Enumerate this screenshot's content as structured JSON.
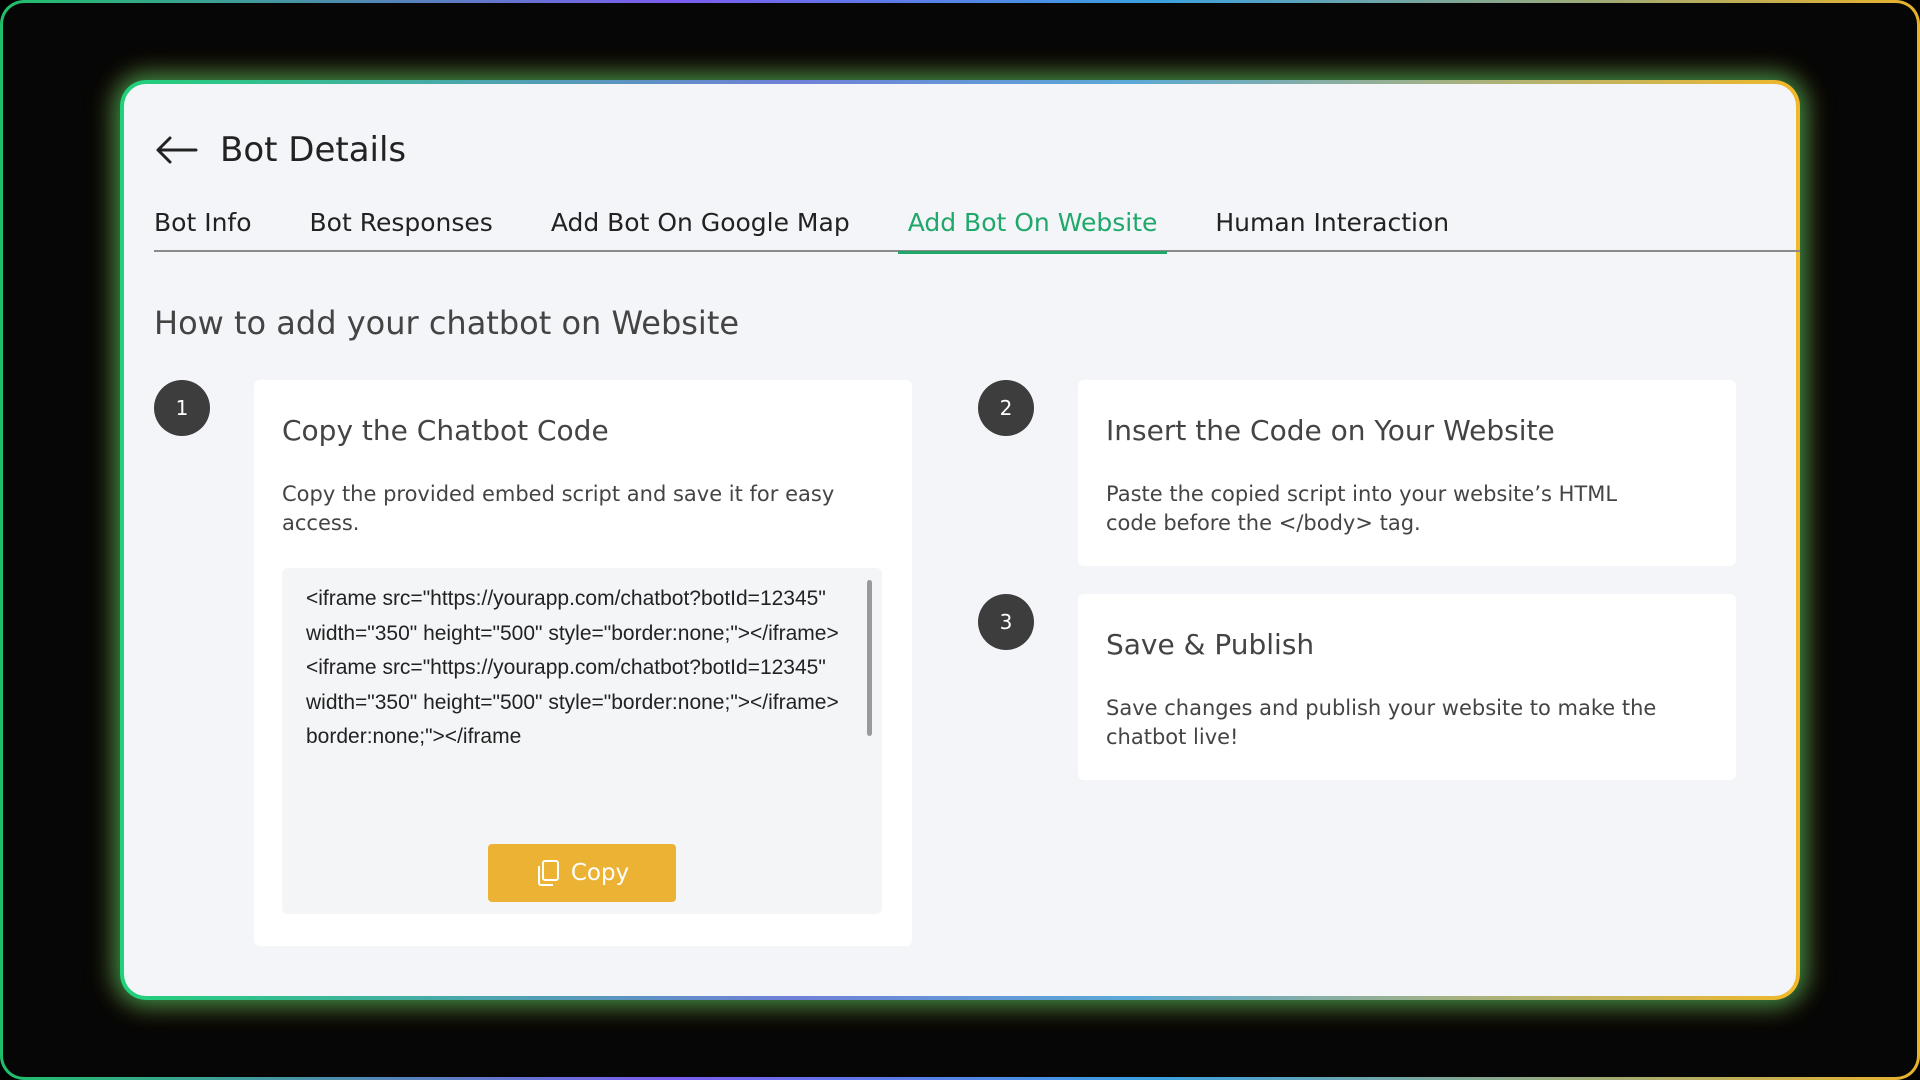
{
  "header": {
    "title": "Bot Details"
  },
  "tabs": [
    {
      "label": "Bot Info",
      "active": false
    },
    {
      "label": "Bot Responses",
      "active": false
    },
    {
      "label": "Add Bot On Google Map",
      "active": false
    },
    {
      "label": "Add Bot On Website",
      "active": true
    },
    {
      "label": "Human Interaction",
      "active": false
    }
  ],
  "section": {
    "title": "How to add your chatbot on Website"
  },
  "steps": [
    {
      "number": "1",
      "title": "Copy the Chatbot Code",
      "description": "Copy the provided embed script and save it for easy access.",
      "code": "<iframe src=\"https://yourapp.com/chatbot?botId=12345\" width=\"350\" height=\"500\" style=\"border:none;\"></iframe>\n<iframe src=\"https://yourapp.com/chatbot?botId=12345\" width=\"350\" height=\"500\" style=\"border:none;\"></iframe>\nborder:none;\"></iframe",
      "copy_label": "Copy"
    },
    {
      "number": "2",
      "title": "Insert the Code on Your Website",
      "description": "Paste the copied script into your website’s HTML code before the </body> tag."
    },
    {
      "number": "3",
      "title": "Save & Publish",
      "description": "Save changes and publish your website to make the chatbot live!"
    }
  ],
  "colors": {
    "accent_green": "#1fa86a",
    "copy_button": "#ebb233",
    "step_badge": "#3d3d3d"
  },
  "icons": {
    "back": "arrow-left-icon",
    "copy": "copy-icon"
  }
}
